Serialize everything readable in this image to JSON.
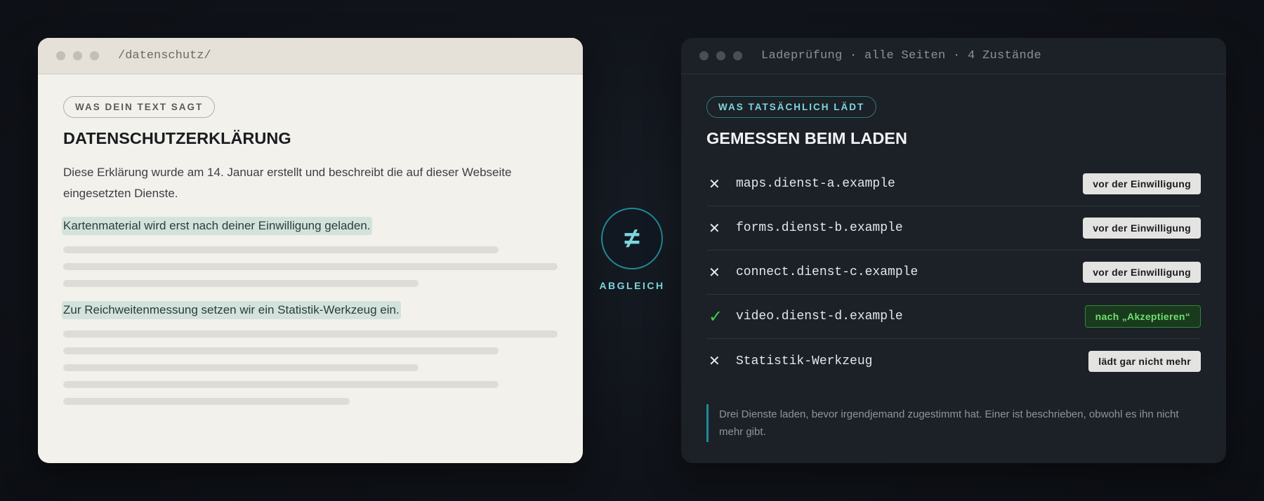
{
  "left_window": {
    "path": "/datenschutz/",
    "pill": "WAS DEIN TEXT SAGT",
    "title": "DATENSCHUTZERKLÄRUNG",
    "intro": "Diese Erklärung wurde am 14. Januar erstellt und beschreibt die auf dieser Webseite eingesetzten Dienste.",
    "highlight_1": "Kartenmaterial wird erst nach deiner Einwilligung geladen.",
    "highlight_2": "Zur Reichweitenmessung setzen wir ein Statistik-Werkzeug ein."
  },
  "center": {
    "symbol": "≠",
    "label": "ABGLEICH"
  },
  "right_window": {
    "path": "Ladeprüfung · alle Seiten · 4 Zustände",
    "pill": "WAS TATSÄCHLICH LÄDT",
    "title": "GEMESSEN BEIM LADEN",
    "rows": [
      {
        "icon": "✕",
        "name": "maps.dienst-a.example",
        "badge": "vor der Einwilligung"
      },
      {
        "icon": "✕",
        "name": "forms.dienst-b.example",
        "badge": "vor der Einwilligung"
      },
      {
        "icon": "✕",
        "name": "connect.dienst-c.example",
        "badge": "vor der Einwilligung"
      },
      {
        "icon": "✓",
        "name": "video.dienst-d.example",
        "badge": "nach „Akzeptieren“"
      },
      {
        "icon": "✕",
        "name": "Statistik-Werkzeug",
        "badge": "lädt gar nicht mehr"
      }
    ],
    "note": "Drei Dienste laden, bevor irgendjemand zugestimmt hat. Einer ist beschrieben, obwohl es ihn nicht mehr gibt."
  },
  "colors": {
    "accent_teal": "#7dd6de",
    "ok_green": "#3ecf4a"
  }
}
